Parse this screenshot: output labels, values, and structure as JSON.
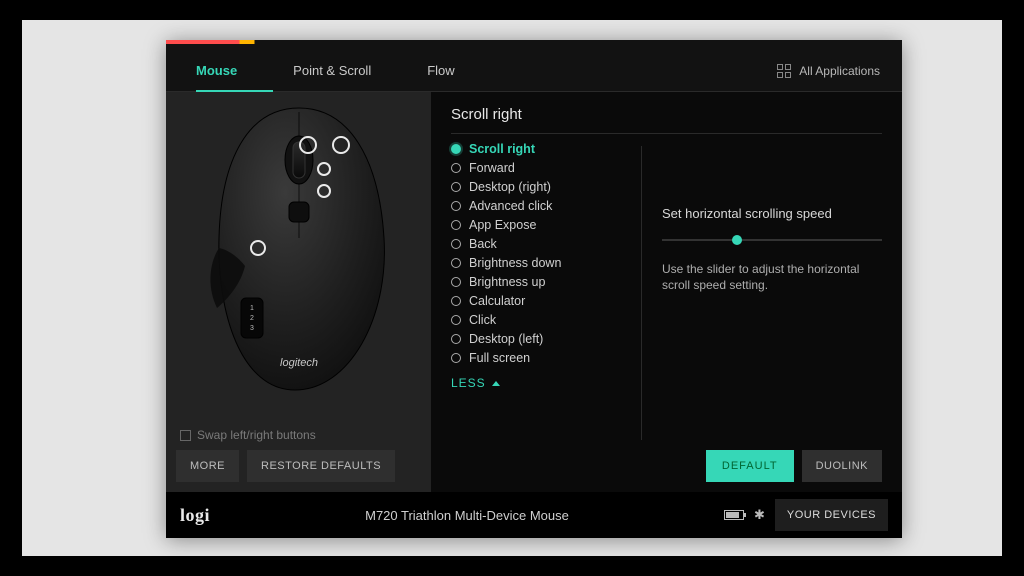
{
  "colors": {
    "accent": "#36d7b7"
  },
  "tabs": {
    "mouse": "Mouse",
    "point_scroll": "Point & Scroll",
    "flow": "Flow"
  },
  "header": {
    "all_apps": "All Applications"
  },
  "left": {
    "swap_label": "Swap left/right buttons",
    "more": "MORE",
    "restore": "RESTORE DEFAULTS",
    "brand_on_mouse": "logitech"
  },
  "right": {
    "title": "Scroll right",
    "options": [
      "Scroll right",
      "Forward",
      "Desktop (right)",
      "Advanced click",
      "App Expose",
      "Back",
      "Brightness down",
      "Brightness up",
      "Calculator",
      "Click",
      "Desktop (left)",
      "Full screen"
    ],
    "selected_index": 0,
    "less": "LESS",
    "settings_heading": "Set horizontal scrolling speed",
    "settings_desc": "Use the slider to adjust the horizontal scroll speed setting.",
    "default_btn": "DEFAULT",
    "duolink_btn": "DUOLINK"
  },
  "footer": {
    "brand": "logi",
    "device": "M720 Triathlon Multi-Device Mouse",
    "your_devices": "YOUR DEVICES"
  }
}
